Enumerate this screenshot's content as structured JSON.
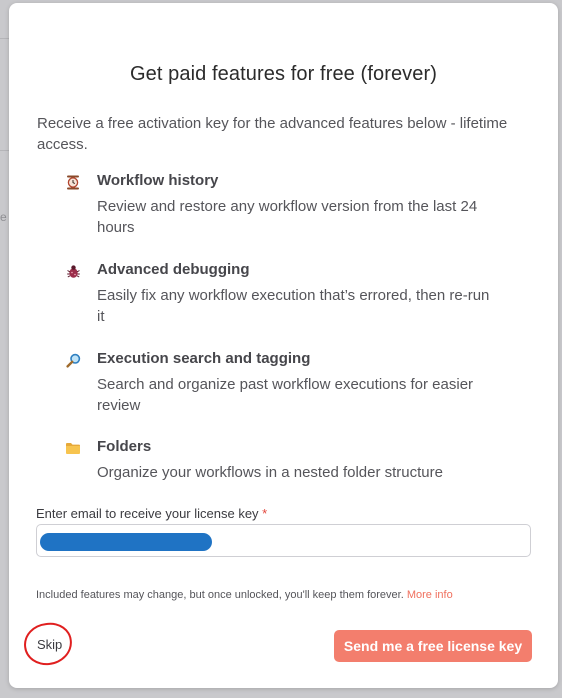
{
  "dialog": {
    "title": "Get paid features for free (forever)",
    "intro": "Receive a free activation key for the advanced features below - lifetime access.",
    "features": [
      {
        "icon": "clock-icon",
        "title": "Workflow history",
        "desc": "Review and restore any workflow version from the last 24 hours"
      },
      {
        "icon": "bug-icon",
        "title": "Advanced debugging",
        "desc": "Easily fix any workflow execution that’s errored, then re-run it"
      },
      {
        "icon": "magnifier-icon",
        "title": "Execution search and tagging",
        "desc": "Search and organize past workflow executions for easier review"
      },
      {
        "icon": "folder-icon",
        "title": "Folders",
        "desc": "Organize your workflows in a nested folder structure"
      }
    ],
    "email": {
      "label": "Enter email to receive your license key",
      "required_mark": "*",
      "value": ""
    },
    "footnote": "Included features may change, but once unlocked, you'll keep them forever.",
    "more_info": "More info",
    "skip_label": "Skip",
    "send_label": "Send me a free license key"
  },
  "colors": {
    "accent": "#f37e6d",
    "link": "#f0705e",
    "required": "#e3463b",
    "annotation": "#e01f1f",
    "redaction": "#1f73c4"
  }
}
